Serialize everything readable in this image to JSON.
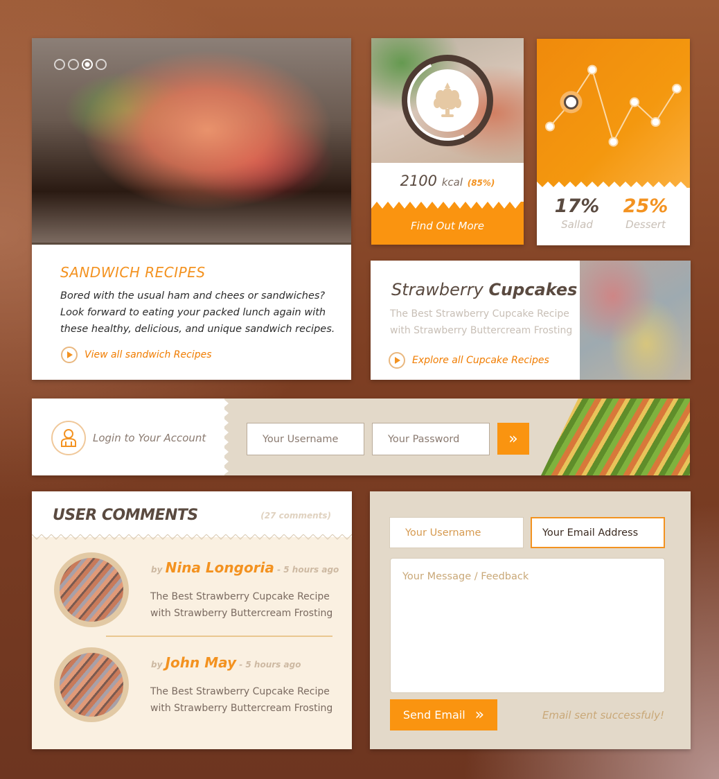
{
  "colors": {
    "accent": "#fa9410",
    "dark_text": "#5a4a40",
    "muted_text": "#c8bfb6",
    "beige": "#e3d9c9"
  },
  "slider": {
    "dots_total": 4,
    "active_dot": 3
  },
  "sandwich": {
    "title": "SANDWICH RECIPES",
    "description": "Bored with the usual ham and chees or sandwiches? Look forward to eating your packed lunch again with these healthy, delicious, and unique sandwich recipes.",
    "link": "View all sandwich Recipes"
  },
  "calorie": {
    "value": "2100",
    "unit": "kcal",
    "percent": "(85%)",
    "progress": 0.85,
    "cta": "Find Out More",
    "icon": "artichoke-icon"
  },
  "chart_data": {
    "type": "line",
    "y_relative": [
      0.35,
      0.62,
      0.98,
      0.18,
      0.62,
      0.4,
      0.77
    ],
    "highlight_index": 1,
    "stats": [
      {
        "value": "17%",
        "label": "Sallad"
      },
      {
        "value": "25%",
        "label": "Dessert"
      }
    ]
  },
  "cupcake": {
    "title_regular": "Strawberry",
    "title_bold": "Cupcakes",
    "description": "The Best Strawberry Cupcake Recipe with Strawberry Buttercream Frosting",
    "link": "Explore all Cupcake Recipes"
  },
  "login": {
    "label": "Login to Your Account",
    "username_placeholder": "Your Username",
    "password_placeholder": "Your Password",
    "submit_icon": "double-chevron-right-icon"
  },
  "comments": {
    "title": "USER COMMENTS",
    "count": "(27 comments)",
    "items": [
      {
        "by": "by",
        "name": "Nina Longoria",
        "time": "- 5 hours ago",
        "text": "The Best Strawberry Cupcake Recipe with Strawberry Buttercream Frosting"
      },
      {
        "by": "by",
        "name": "John May",
        "time": "- 5 hours ago",
        "text": "The Best Strawberry Cupcake Recipe with Strawberry Buttercream Frosting"
      }
    ]
  },
  "contact": {
    "username_placeholder": "Your Username",
    "email_value": "Your Email Address",
    "message_placeholder": "Your Message / Feedback",
    "send_label": "Send Email",
    "status": "Email sent successfuly!"
  }
}
